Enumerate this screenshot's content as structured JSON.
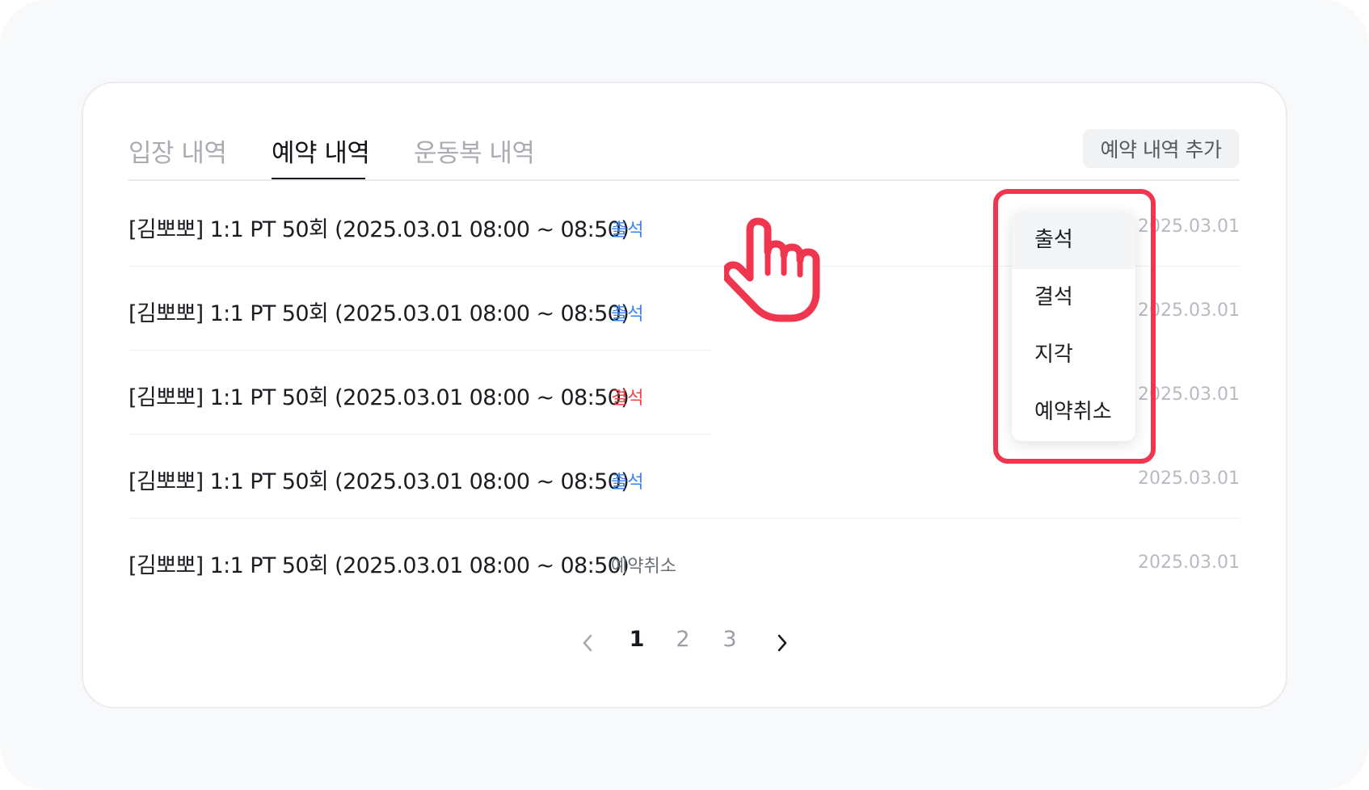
{
  "tabs": [
    {
      "label": "입장 내역",
      "active": false
    },
    {
      "label": "예약 내역",
      "active": true
    },
    {
      "label": "운동복 내역",
      "active": false
    }
  ],
  "add_button_label": "예약 내역 추가",
  "rows": [
    {
      "title": "[김뽀뽀] 1:1 PT 50회 (2025.03.01 08:00 ~ 08:50)",
      "status": "출석",
      "date": "2025.03.01"
    },
    {
      "title": "[김뽀뽀] 1:1 PT 50회 (2025.03.01 08:00 ~ 08:50)",
      "status": "출석",
      "date": "2025.03.01"
    },
    {
      "title": "[김뽀뽀] 1:1 PT 50회 (2025.03.01 08:00 ~ 08:50)",
      "status": "결석",
      "date": "2025.03.01"
    },
    {
      "title": "[김뽀뽀] 1:1 PT 50회 (2025.03.01 08:00 ~ 08:50)",
      "status": "출석",
      "date": "2025.03.01"
    },
    {
      "title": "[김뽀뽀] 1:1 PT 50회 (2025.03.01 08:00 ~ 08:50)",
      "status": "예약취소",
      "date": "2025.03.01"
    }
  ],
  "status_colors": {
    "출석": "#3b82e8",
    "결석": "#ef4444",
    "예약취소": "#6b7076"
  },
  "dropdown": {
    "options": [
      "출석",
      "결석",
      "지각",
      "예약취소"
    ],
    "highlighted_index": 0
  },
  "pagination": {
    "pages": [
      "1",
      "2",
      "3"
    ],
    "current": "1",
    "prev_icon": "chevron-left-icon",
    "next_icon": "chevron-right-icon"
  },
  "overlay": {
    "pointer_icon": "hand-pointer-icon",
    "highlight_color": "#f0364f"
  }
}
